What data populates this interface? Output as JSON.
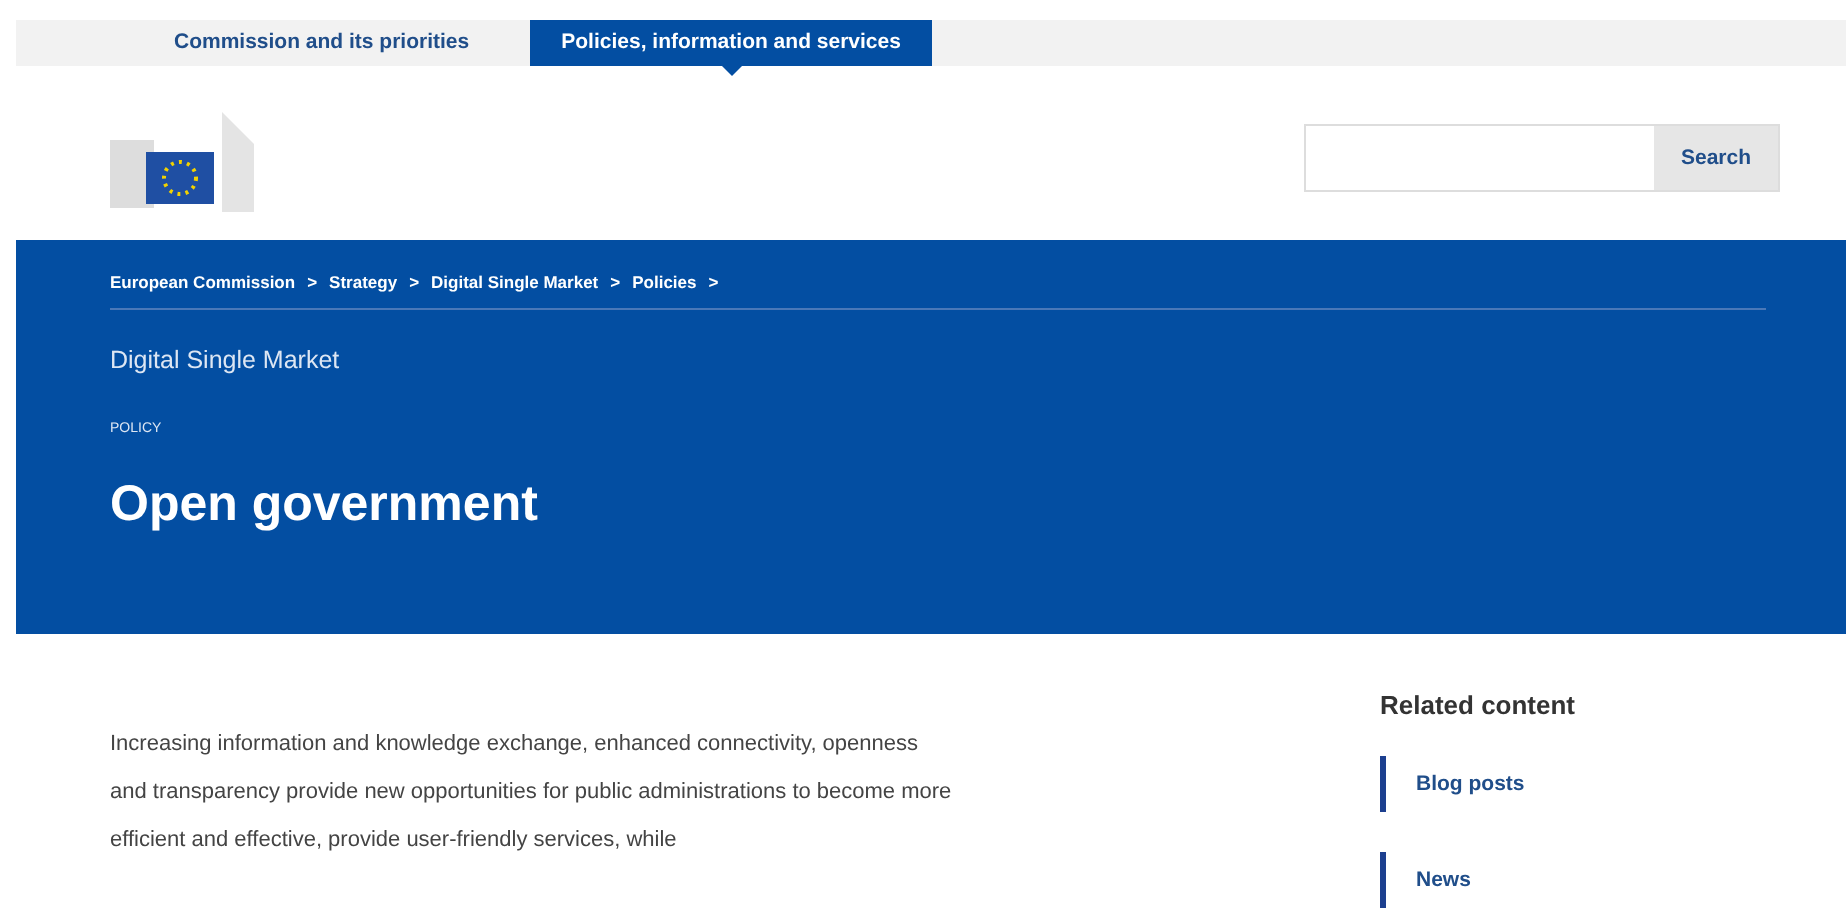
{
  "top_tabs": [
    {
      "label": "Commission and its priorities",
      "selected": false
    },
    {
      "label": "Policies, information and services",
      "selected": true
    }
  ],
  "search": {
    "button": "Search"
  },
  "breadcrumb": [
    "European Commission",
    "Strategy",
    "Digital Single Market",
    "Policies"
  ],
  "breadcrumb_separator": ">",
  "site_name": "Digital Single Market",
  "page_type": "POLICY",
  "title": "Open government",
  "intro": "Increasing information and knowledge exchange, enhanced connectivity, openness and transparency provide new opportunities for public administrations to become more efficient and effective, provide user-friendly services, while",
  "related": {
    "heading": "Related content",
    "items": [
      "Blog posts",
      "News"
    ]
  }
}
